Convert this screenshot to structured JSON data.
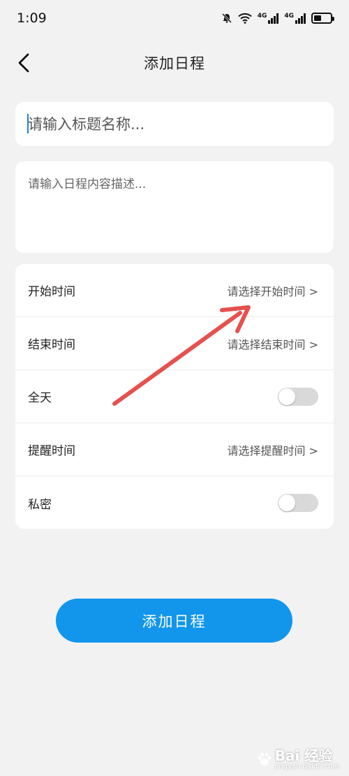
{
  "status_bar": {
    "time": "1:09",
    "net1": "4G",
    "net2": "4G",
    "battery_level": 0.45
  },
  "nav": {
    "title": "添加日程",
    "back_icon": "chevron-left-icon"
  },
  "form": {
    "title_placeholder": "请输入标题名称...",
    "description_placeholder": "请输入日程内容描述..."
  },
  "settings": {
    "start_time": {
      "label": "开始时间",
      "value": "请选择开始时间 >"
    },
    "end_time": {
      "label": "结束时间",
      "value": "请选择结束时间 >"
    },
    "all_day": {
      "label": "全天",
      "enabled": false
    },
    "reminder": {
      "label": "提醒时间",
      "value": "请选择提醒时间 >"
    },
    "private": {
      "label": "私密",
      "enabled": false
    }
  },
  "submit_label": "添加日程",
  "watermark": {
    "brand": "Bai 经验",
    "url": "jingyan.baidu.com"
  },
  "colors": {
    "accent": "#1296ec",
    "background": "#f2f2f2",
    "annotation_arrow": "#e5514e"
  }
}
